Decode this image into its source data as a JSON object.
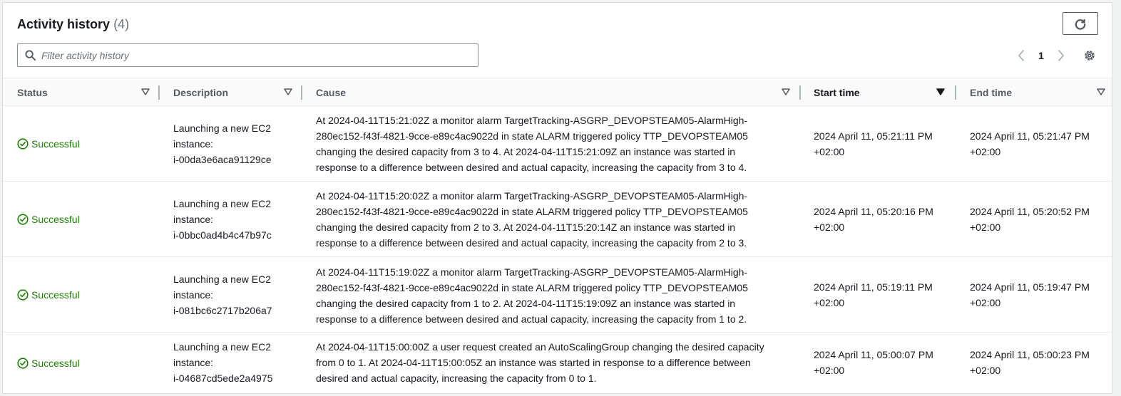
{
  "header": {
    "title": "Activity history",
    "count": "(4)",
    "refresh_icon": "refresh-icon"
  },
  "search": {
    "placeholder": "Filter activity history",
    "value": ""
  },
  "pagination": {
    "current_page": "1"
  },
  "columns": [
    {
      "label": "Status"
    },
    {
      "label": "Description"
    },
    {
      "label": "Cause"
    },
    {
      "label": "Start time"
    },
    {
      "label": "End time"
    }
  ],
  "rows": [
    {
      "status": "Successful",
      "description": [
        "Launching a new EC2",
        "instance:",
        "i-00da3e6aca91129ce"
      ],
      "cause": [
        "At 2024-04-11T15:21:02Z a monitor alarm TargetTracking-ASGRP_DEVOPSTEAM05-AlarmHigh-",
        "280ec152-f43f-4821-9cce-e89c4ac9022d in state ALARM triggered policy TTP_DEVOPSTEAM05",
        "changing the desired capacity from 3 to 4. At 2024-04-11T15:21:09Z an instance was started in",
        "response to a difference between desired and actual capacity, increasing the capacity from 3 to 4."
      ],
      "start_time": [
        "2024 April 11, 05:21:11 PM",
        "+02:00"
      ],
      "end_time": [
        "2024 April 11, 05:21:47 PM",
        "+02:00"
      ]
    },
    {
      "status": "Successful",
      "description": [
        "Launching a new EC2",
        "instance:",
        "i-0bbc0ad4b4c47b97c"
      ],
      "cause": [
        "At 2024-04-11T15:20:02Z a monitor alarm TargetTracking-ASGRP_DEVOPSTEAM05-AlarmHigh-",
        "280ec152-f43f-4821-9cce-e89c4ac9022d in state ALARM triggered policy TTP_DEVOPSTEAM05",
        "changing the desired capacity from 2 to 3. At 2024-04-11T15:20:14Z an instance was started in",
        "response to a difference between desired and actual capacity, increasing the capacity from 2 to 3."
      ],
      "start_time": [
        "2024 April 11, 05:20:16 PM",
        "+02:00"
      ],
      "end_time": [
        "2024 April 11, 05:20:52 PM",
        "+02:00"
      ]
    },
    {
      "status": "Successful",
      "description": [
        "Launching a new EC2",
        "instance:",
        "i-081bc6c2717b206a7"
      ],
      "cause": [
        "At 2024-04-11T15:19:02Z a monitor alarm TargetTracking-ASGRP_DEVOPSTEAM05-AlarmHigh-",
        "280ec152-f43f-4821-9cce-e89c4ac9022d in state ALARM triggered policy TTP_DEVOPSTEAM05",
        "changing the desired capacity from 1 to 2. At 2024-04-11T15:19:09Z an instance was started in",
        "response to a difference between desired and actual capacity, increasing the capacity from 1 to 2."
      ],
      "start_time": [
        "2024 April 11, 05:19:11 PM",
        "+02:00"
      ],
      "end_time": [
        "2024 April 11, 05:19:47 PM",
        "+02:00"
      ]
    },
    {
      "status": "Successful",
      "description": [
        "Launching a new EC2",
        "instance:",
        "i-04687cd5ede2a4975"
      ],
      "cause": [
        "At 2024-04-11T15:00:00Z a user request created an AutoScalingGroup changing the desired capacity",
        "from 0 to 1. At 2024-04-11T15:00:05Z an instance was started in response to a difference between",
        "desired and actual capacity, increasing the capacity from 0 to 1."
      ],
      "start_time": [
        "2024 April 11, 05:00:07 PM",
        "+02:00"
      ],
      "end_time": [
        "2024 April 11, 05:00:23 PM",
        "+02:00"
      ]
    }
  ],
  "colors": {
    "success": "#1d8102",
    "header_text": "#545b64",
    "text": "#16191f"
  }
}
